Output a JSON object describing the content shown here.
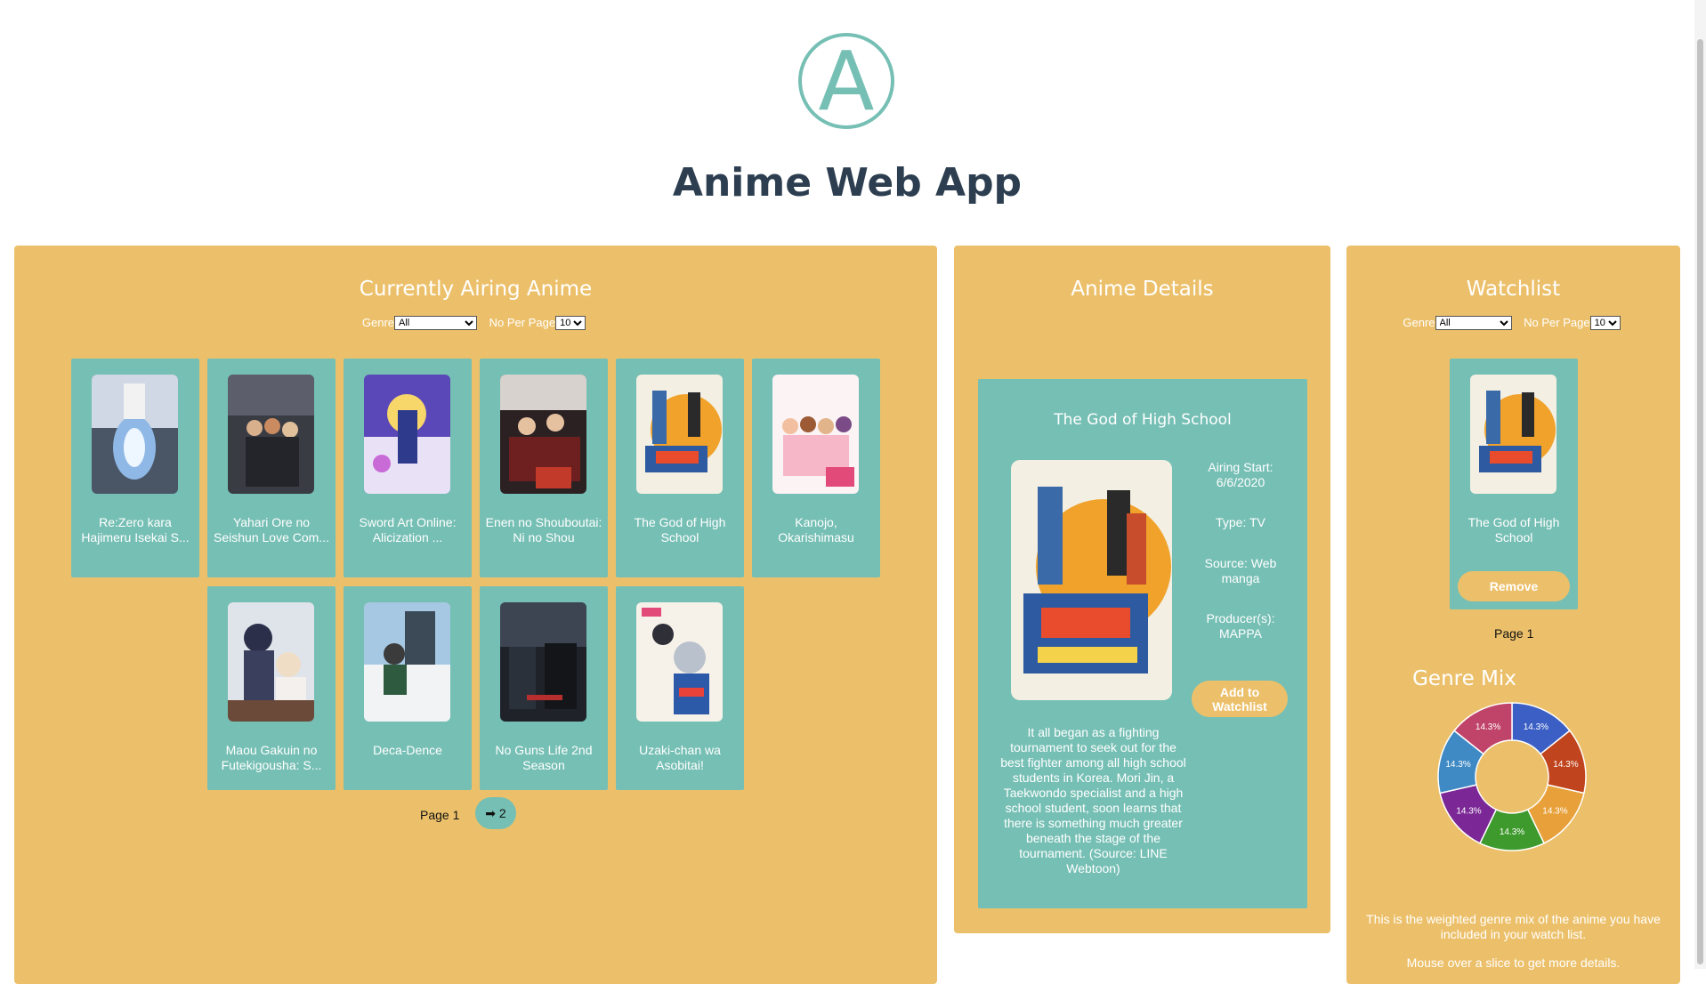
{
  "app": {
    "logo_letter": "A",
    "title": "Anime Web App",
    "accent_color": "#76bfb4",
    "panel_color": "#ecc06a"
  },
  "airing": {
    "title": "Currently Airing Anime",
    "genre_label": "Genre",
    "genre_value": "All",
    "per_page_label": "No Per Page",
    "per_page_value": "10",
    "cards": [
      {
        "title": "Re:Zero kara Hajimeru Isekai S..."
      },
      {
        "title": "Yahari Ore no Seishun Love Com..."
      },
      {
        "title": "Sword Art Online: Alicization ..."
      },
      {
        "title": "Enen no Shouboutai: Ni no Shou"
      },
      {
        "title": "The God of High School"
      },
      {
        "title": "Kanojo, Okarishimasu"
      },
      {
        "title": "Maou Gakuin no Futekigousha: S..."
      },
      {
        "title": "Deca-Dence"
      },
      {
        "title": "No Guns Life 2nd Season"
      },
      {
        "title": "Uzaki-chan wa Asobitai!"
      }
    ],
    "page_label": "Page 1",
    "next_label": "➡ 2"
  },
  "details": {
    "title": "Anime Details",
    "anime_title": "The God of High School",
    "airing_start": "Airing Start: 6/6/2020",
    "type": "Type: TV",
    "source": "Source: Web manga",
    "producers": "Producer(s): MAPPA",
    "add_button": "Add to Watchlist",
    "synopsis": "It all began as a fighting tournament to seek out for the best fighter among all high school students in Korea. Mori Jin, a Taekwondo specialist and a high school student, soon learns that there is something much greater beneath the stage of the tournament. (Source: LINE Webtoon)"
  },
  "watchlist": {
    "title": "Watchlist",
    "genre_label": "Genre",
    "genre_value": "All",
    "per_page_label": "No Per Page",
    "per_page_value": "10",
    "item_title": "The God of High School",
    "remove_button": "Remove",
    "page_label": "Page 1",
    "genre_mix_title": "Genre Mix",
    "genre_mix_text": "This is the weighted genre mix of the anime you have included in your watch list.",
    "genre_mix_hint": "Mouse over a slice to get more details."
  },
  "chart_data": {
    "type": "pie",
    "slices": [
      {
        "label": "14.3%",
        "value": 14.3,
        "color": "#3b5fc4"
      },
      {
        "label": "14.3%",
        "value": 14.3,
        "color": "#c0441d"
      },
      {
        "label": "14.3%",
        "value": 14.3,
        "color": "#e8a13a"
      },
      {
        "label": "14.3%",
        "value": 14.3,
        "color": "#3e9a2c"
      },
      {
        "label": "14.3%",
        "value": 14.3,
        "color": "#7b2896"
      },
      {
        "label": "14.3%",
        "value": 14.3,
        "color": "#3f8ac4"
      },
      {
        "label": "14.3%",
        "value": 14.3,
        "color": "#c0446a"
      }
    ]
  }
}
